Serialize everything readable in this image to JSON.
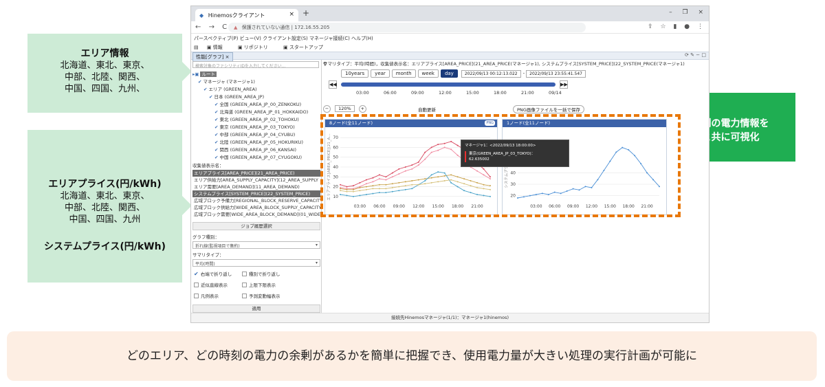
{
  "annotations": {
    "area_title": "エリア情報",
    "area_lines": [
      "北海道、東北、東京、",
      "中部、北陸、関西、",
      "中国、四国、九州、"
    ],
    "price_title": "エリアプライス(円/kWh)",
    "price_lines": [
      "北海道、東北、東京、",
      "中部、北陸、関西、",
      "中国、四国、九州"
    ],
    "system_title": "システムプライス(円/kWh)",
    "viz_lines": [
      "エリア別の電力情報を",
      "通知と共に可視化"
    ],
    "bottom_text": "どのエリア、どの時刻の電力の余剰があるかを簡単に把握でき、使用電力量が大きい処理の実行計画が可能に"
  },
  "browser": {
    "tab_title": "Hinemosクライアント",
    "tab_close": "×",
    "new_tab": "+",
    "win_min": "–",
    "win_max": "❐",
    "win_close": "×",
    "nav_back": "←",
    "nav_forward": "→",
    "nav_reload": "C",
    "security_warn": "▲",
    "security_label": "保護されていない通信",
    "url": "172.16.55.205"
  },
  "app": {
    "menu": "パースペクティブ(P)  ビュー(V)  クライアント設定(S)  マネージャ接続(C)  ヘルプ(H)",
    "toolbar": [
      "情報",
      "リポジトリ",
      "スタートアップ"
    ],
    "view_tab": "性能[グラフ] ×",
    "facility_search_placeholder": "検索対象のファシリティIDを入力してください...",
    "tree": [
      {
        "label": "ルート",
        "indent": 0,
        "selected": true
      },
      {
        "label": "マネージャ (マネージャ1)",
        "indent": 1
      },
      {
        "label": "エリア (GREEN_AREA)",
        "indent": 2
      },
      {
        "label": "日本 (GREEN_AREA_JP)",
        "indent": 3
      },
      {
        "label": "全国 (GREEN_AREA_JP_00_ZENKOKU)",
        "indent": 4
      },
      {
        "label": "北海道 (GREEN_AREA_JP_01_HOKKAIDO)",
        "indent": 4
      },
      {
        "label": "東北 (GREEN_AREA_JP_02_TOHOKU)",
        "indent": 4
      },
      {
        "label": "東京 (GREEN_AREA_JP_03_TOKYO)",
        "indent": 4
      },
      {
        "label": "中部 (GREEN_AREA_JP_04_CYUBU)",
        "indent": 4
      },
      {
        "label": "北陸 (GREEN_AREA_JP_05_HOKURIKU)",
        "indent": 4
      },
      {
        "label": "関西 (GREEN_AREA_JP_06_KANSAI)",
        "indent": 4
      },
      {
        "label": "中国 (GREEN_AREA_JP_07_CYUGOKU)",
        "indent": 4
      }
    ],
    "item_label": "収集値表示名：",
    "items": [
      {
        "label": "エリアプライス[AREA_PRICE](21_AREA_PRICE)",
        "selected": true
      },
      {
        "label": "エリア供給力[AREA_SUPPLY_CAPACITY](12_AREA_SUPPLY",
        "selected": false
      },
      {
        "label": "エリア需要[AREA_DEMAND](11_AREA_DEMAND)",
        "selected": false
      },
      {
        "label": "システムプライス[SYSTEM_PRICE](22_SYSTEM_PRICE)",
        "selected": true
      },
      {
        "label": "広域ブロック予備力[REGIONAL_BLOCK_RESERVE_CAPACITY",
        "selected": false
      },
      {
        "label": "広域ブロック供給力[WIDE_AREA_BLOCK_SUPPLY_CAPACITY",
        "selected": false
      },
      {
        "label": "広域ブロック需要[WIDE_AREA_BLOCK_DEMAND](01_WIDE",
        "selected": false
      }
    ],
    "job_button": "ジョブ履歴選択",
    "graph_type_label": "グラフ種別：",
    "graph_type_value": "折れ線(監視項目で集約)",
    "summary_type_label": "サマリタイプ：",
    "summary_type_value": "平均(時間)",
    "caret": "▾",
    "options": [
      {
        "label": "右端で折り返し",
        "checked": true
      },
      {
        "label": "種別で折り返し",
        "checked": false
      },
      {
        "label": "近似直線表示",
        "checked": false
      },
      {
        "label": "上限下限表示",
        "checked": false
      },
      {
        "label": "凡例表示",
        "checked": false
      },
      {
        "label": "予測変動幅表示",
        "checked": false
      }
    ],
    "apply_button": "適用",
    "summary_line": "サマリタイプ：平均(時間)，収集値表示名：エリアプライス[AREA_PRICE](21_AREA_PRICE(マネージャ1), システムプライス[SYSTEM_PRICE](22_SYSTEM_PRICE(マネージャ1)",
    "range_buttons": [
      {
        "label": "10years",
        "active": false
      },
      {
        "label": "year",
        "active": false
      },
      {
        "label": "month",
        "active": false
      },
      {
        "label": "week",
        "active": false
      },
      {
        "label": "day",
        "active": true
      }
    ],
    "date_from": "2022/09/13 00:12:13.022",
    "date_sep": "-",
    "date_to": "2022/09/13 23:55:41.547",
    "timeline_prev": "◀◀",
    "timeline_next": "▶▶",
    "timeline_ticks": [
      "03:00",
      "06:00",
      "09:00",
      "12:00",
      "15:00",
      "18:00",
      "21:00",
      "09/14"
    ],
    "zoom_minus": "−",
    "zoom_value": "120%",
    "zoom_plus": "+",
    "auto_update": "自動更新",
    "png_save": "PNG画像ファイルを一括で保存",
    "chart1_title": "8ノード(全11ノード)",
    "chart1_png": "PNG",
    "chart2_title": "1ノード(全11ノード)",
    "tooltip_head": "マネージャ1：<2022/09/13 18:00:00>",
    "tooltip_series": "東京(GREEN_AREA_JP_03_TOKYO)：",
    "tooltip_value": "62.635002",
    "status": "接続先Hinemosマネージャ(1/1)：マネージャ1(hinemos)"
  },
  "chart_data": [
    {
      "type": "line",
      "title": "8ノード(全11ノード)",
      "ylabel": "エリアプライス[AREA_PRICE](21_A…",
      "ylim": [
        5,
        75
      ],
      "yticks": [
        10,
        20,
        30,
        40,
        50,
        60,
        70
      ],
      "xticks": [
        "03:00",
        "06:00",
        "09:00",
        "12:00",
        "15:00",
        "18:00",
        "21:00"
      ],
      "x": [
        0,
        1,
        2,
        3,
        4,
        5,
        6,
        7,
        8,
        9,
        10,
        11,
        12,
        13,
        14,
        15,
        16,
        17,
        18,
        19,
        20,
        21,
        22,
        23
      ],
      "series": [
        {
          "color": "#d9485f",
          "values": [
            22,
            20,
            21,
            24,
            27,
            29,
            32,
            30,
            34,
            38,
            40,
            42,
            45,
            55,
            60,
            63,
            64,
            66,
            62,
            58,
            50,
            44,
            38,
            30
          ]
        },
        {
          "color": "#f08aa0",
          "values": [
            19,
            18,
            18,
            20,
            23,
            25,
            28,
            27,
            30,
            33,
            36,
            38,
            42,
            48,
            55,
            57,
            60,
            58,
            52,
            47,
            40,
            36,
            32,
            28
          ]
        },
        {
          "color": "#c9a24a",
          "values": [
            18,
            17,
            17,
            19,
            20,
            21,
            22,
            22,
            23,
            24,
            25,
            26,
            27,
            28,
            29,
            30,
            31,
            32,
            30,
            28,
            26,
            24,
            22,
            21
          ]
        },
        {
          "color": "#4aa3c9",
          "values": [
            12,
            11,
            10,
            11,
            12,
            13,
            14,
            14,
            15,
            16,
            17,
            18,
            22,
            26,
            32,
            35,
            34,
            24,
            20,
            16,
            14,
            12,
            11,
            10
          ]
        },
        {
          "color": "#d6c07a",
          "values": [
            16,
            15,
            15,
            16,
            17,
            18,
            18,
            18,
            19,
            20,
            21,
            22,
            22,
            23,
            24,
            25,
            26,
            27,
            25,
            23,
            21,
            19,
            18,
            17
          ]
        }
      ]
    },
    {
      "type": "line",
      "title": "1ノード(全11ノード)",
      "ylabel": "システムプライス[SYS…",
      "ylim": [
        15,
        75
      ],
      "yticks": [
        20,
        30,
        40
      ],
      "xticks": [
        "03:00",
        "06:00",
        "09:00",
        "12:00",
        "15:00",
        "18:00",
        "21:00"
      ],
      "x": [
        0,
        1,
        2,
        3,
        4,
        5,
        6,
        7,
        8,
        9,
        10,
        11,
        12,
        13,
        14,
        15,
        16,
        17,
        18,
        19,
        20,
        21,
        22,
        23
      ],
      "series": [
        {
          "color": "#4a8fd6",
          "values": [
            18,
            19,
            20,
            21,
            22,
            21,
            23,
            22,
            24,
            26,
            25,
            28,
            27,
            34,
            42,
            50,
            58,
            62,
            60,
            55,
            48,
            40,
            34,
            28
          ]
        }
      ]
    }
  ]
}
